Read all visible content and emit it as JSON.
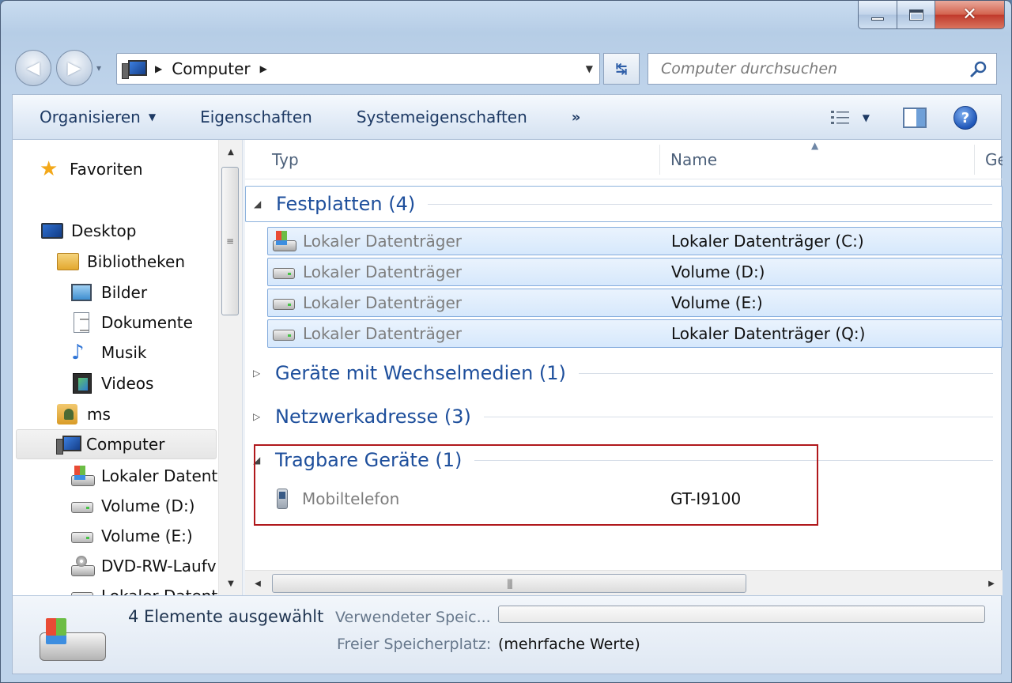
{
  "window": {
    "caption_min": "—",
    "caption_max": "",
    "caption_close": "✕"
  },
  "nav": {
    "back": "◀",
    "forward": "▶",
    "recent": "▾",
    "address_crumb": "Computer",
    "address_sep": "▶",
    "address_drop": "▼",
    "refresh": "↹",
    "search_placeholder": "Computer durchsuchen"
  },
  "toolbar": {
    "organize": "Organisieren",
    "properties": "Eigenschaften",
    "system_properties": "Systemeigenschaften",
    "more": "»",
    "help": "?"
  },
  "sidebar": {
    "items": [
      {
        "label": "Favoriten",
        "icon": "star-icon"
      },
      {
        "label": "Desktop",
        "icon": "monitor-icon"
      },
      {
        "label": "Bibliotheken",
        "icon": "folder-icon"
      },
      {
        "label": "Bilder",
        "icon": "picture-icon"
      },
      {
        "label": "Dokumente",
        "icon": "document-icon"
      },
      {
        "label": "Musik",
        "icon": "music-icon"
      },
      {
        "label": "Videos",
        "icon": "film-icon"
      },
      {
        "label": "ms",
        "icon": "user-folder-icon"
      },
      {
        "label": "Computer",
        "icon": "computer-icon"
      },
      {
        "label": "Lokaler Datentr",
        "icon": "system-drive-icon"
      },
      {
        "label": "Volume (D:)",
        "icon": "drive-icon"
      },
      {
        "label": "Volume (E:)",
        "icon": "drive-icon"
      },
      {
        "label": "DVD-RW-Laufv",
        "icon": "dvd-drive-icon"
      },
      {
        "label": "Lokaler Datent",
        "icon": "drive-icon"
      }
    ]
  },
  "columns": {
    "type": "Typ",
    "name": "Name",
    "third": "Ge"
  },
  "groups": {
    "hdd": "Festplatten (4)",
    "removable": "Geräte mit Wechselmedien (1)",
    "network": "Netzwerkadresse (3)",
    "portable": "Tragbare Geräte (1)"
  },
  "drives": [
    {
      "type": "Lokaler Datenträger",
      "name": "Lokaler Datenträger (C:)"
    },
    {
      "type": "Lokaler Datenträger",
      "name": "Volume (D:)"
    },
    {
      "type": "Lokaler Datenträger",
      "name": "Volume (E:)"
    },
    {
      "type": "Lokaler Datenträger",
      "name": "Lokaler Datenträger (Q:)"
    }
  ],
  "portable_device": {
    "type": "Mobiltelefon",
    "name": "GT-I9100"
  },
  "details": {
    "selected": "4 Elemente ausgewählt",
    "used_label": "Verwendeter Speic...",
    "free_label": "Freier Speicherplatz:",
    "free_value": "(mehrfache Werte)"
  },
  "colors": {
    "accent": "#1e4f9c",
    "highlight_box": "#b0181c",
    "selection": "#d6e8fc"
  }
}
